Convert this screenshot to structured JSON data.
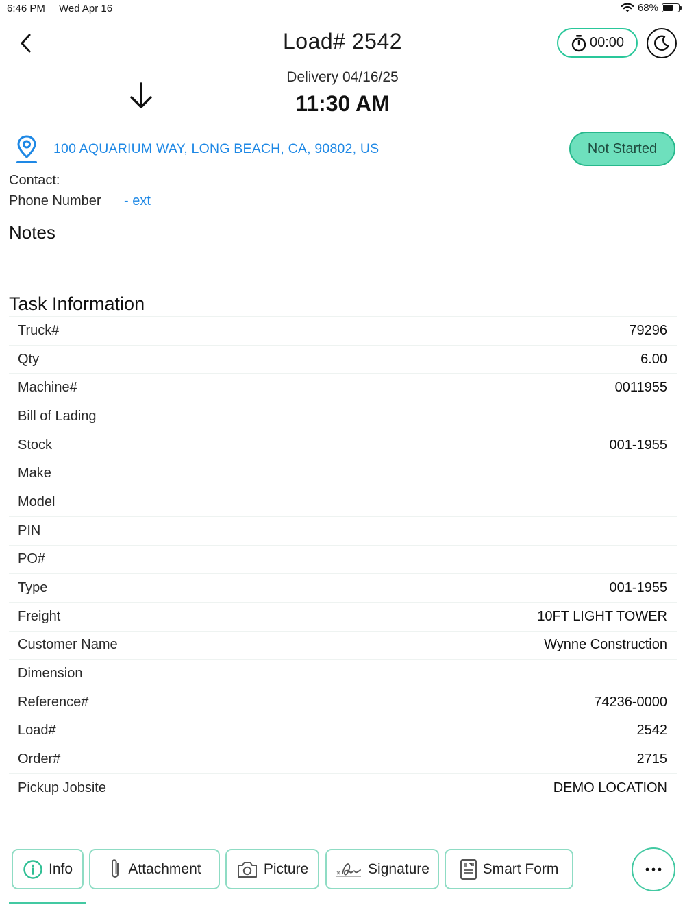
{
  "status_bar": {
    "time": "6:46 PM",
    "date": "Wed Apr 16",
    "battery": "68%",
    "battery_level": 0.68
  },
  "header": {
    "title": "Load# 2542",
    "timer": "00:00"
  },
  "delivery": {
    "label": "Delivery 04/16/25",
    "time": "11:30 AM"
  },
  "location": {
    "address": "100 AQUARIUM WAY, LONG BEACH, CA, 90802, US",
    "status": "Not Started"
  },
  "contact": {
    "label": "Contact:",
    "phone_label": "Phone Number",
    "ext": "- ext"
  },
  "sections": {
    "notes": "Notes",
    "task_information": "Task Information"
  },
  "task_information": [
    {
      "key": "Truck#",
      "value": "79296"
    },
    {
      "key": "Qty",
      "value": "6.00"
    },
    {
      "key": "Machine#",
      "value": "0011955"
    },
    {
      "key": "Bill of Lading",
      "value": ""
    },
    {
      "key": "Stock",
      "value": "001-1955"
    },
    {
      "key": "Make",
      "value": ""
    },
    {
      "key": "Model",
      "value": ""
    },
    {
      "key": "PIN",
      "value": ""
    },
    {
      "key": "PO#",
      "value": ""
    },
    {
      "key": "Type",
      "value": "001-1955"
    },
    {
      "key": "Freight",
      "value": "10FT LIGHT TOWER"
    },
    {
      "key": "Customer Name",
      "value": "Wynne Construction"
    },
    {
      "key": "Dimension",
      "value": ""
    },
    {
      "key": "Reference#",
      "value": "74236-0000"
    },
    {
      "key": "Load#",
      "value": "2542"
    },
    {
      "key": "Order#",
      "value": "2715"
    },
    {
      "key": "Pickup Jobsite",
      "value": "DEMO LOCATION"
    }
  ],
  "tabs": [
    {
      "label": "Info",
      "icon": "info-icon"
    },
    {
      "label": "Attachment",
      "icon": "paperclip-icon"
    },
    {
      "label": "Picture",
      "icon": "camera-icon"
    },
    {
      "label": "Signature",
      "icon": "signature-icon"
    },
    {
      "label": "Smart Form",
      "icon": "form-icon"
    }
  ],
  "colors": {
    "accent": "#43c9a2",
    "link": "#1e88e5",
    "status_fill": "#6ee0bd"
  }
}
